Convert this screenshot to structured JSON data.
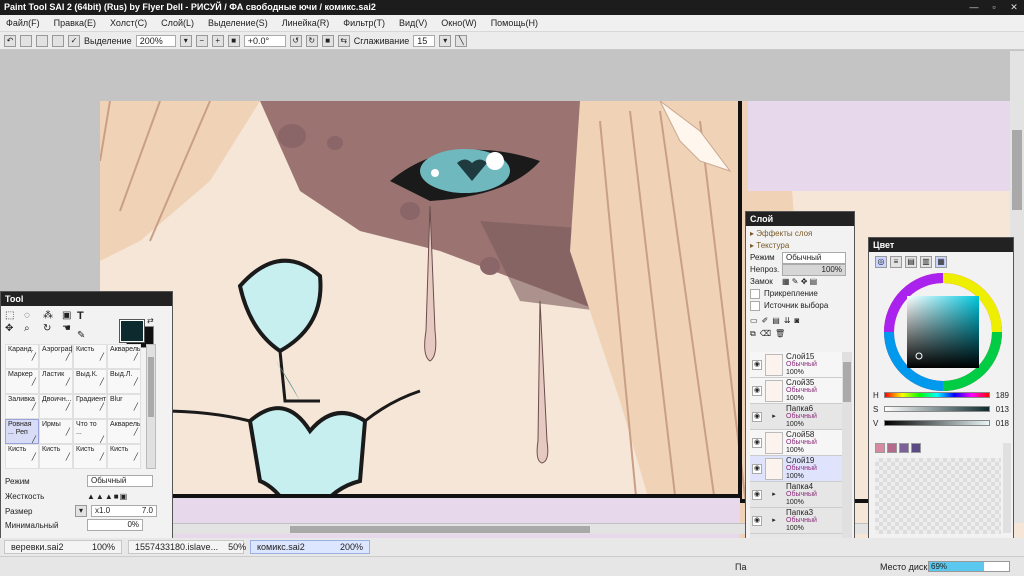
{
  "window": {
    "title": "Paint Tool SAI 2 (64bit) (Rus) by Flyer Dell - РИСУЙ / ФА свободные ючи / комикс.sai2"
  },
  "menu": [
    "Файл(F)",
    "Правка(E)",
    "Холст(C)",
    "Слой(L)",
    "Выделение(S)",
    "Линейка(R)",
    "Фильтр(T)",
    "Вид(V)",
    "Окно(W)",
    "Помощь(H)"
  ],
  "toolbar": {
    "selection_label": "Выделение",
    "zoom": "200%",
    "rotation": "+0.0°",
    "smoothing_label": "Сглаживание",
    "smoothing_value": "15"
  },
  "tool_panel": {
    "title": "Tool",
    "tools": [
      [
        "Каранд.",
        "Аэрограф",
        "Кисть",
        "Акварель"
      ],
      [
        "Маркер",
        "Ластик",
        "Выд.К.",
        "Выд.Л."
      ],
      [
        "Заливка",
        "Двоичн...",
        "Градиент",
        "Blur"
      ],
      [
        "Ровная ... Реп",
        "Ирмы",
        "Что то ...",
        "Акварель"
      ],
      [
        "Кисть",
        "Кисть",
        "Кисть",
        "Кисть"
      ]
    ],
    "mode_label": "Режим",
    "mode_value": "Обычный",
    "hardness_label": "Жесткость",
    "size_label": "Размер",
    "size_multiplier": "x1.0",
    "size_value": "7.0",
    "min_label": "Минимальный",
    "min_value": "0%",
    "fg_color": "#0d2a2e",
    "bg_color": "#111111"
  },
  "layer_panel": {
    "title": "Слой",
    "effects": "Эффекты слоя",
    "texture": "Текстура",
    "mode_label": "Режим",
    "mode_value": "Обычный",
    "opacity_label": "Непроз.",
    "opacity_value": "100%",
    "lock_label": "Замок",
    "clip_label": "Прикрепление",
    "source_label": "Источник выбора",
    "layers": [
      {
        "name": "Слой15",
        "mode": "Обычный",
        "opacity": "100%",
        "type": "layer"
      },
      {
        "name": "Слой35",
        "mode": "Обычный",
        "opacity": "100%",
        "type": "layer"
      },
      {
        "name": "Папка6",
        "mode": "Обычный",
        "opacity": "100%",
        "type": "folder"
      },
      {
        "name": "Слой58",
        "mode": "Обычный",
        "opacity": "100%",
        "type": "layer"
      },
      {
        "name": "Слой19",
        "mode": "Обычный",
        "opacity": "100%",
        "type": "selected"
      },
      {
        "name": "Папка4",
        "mode": "Обычный",
        "opacity": "100%",
        "type": "folder"
      },
      {
        "name": "Папка3",
        "mode": "Обычный",
        "opacity": "100%",
        "type": "folder"
      },
      {
        "name": "Папка2",
        "mode": "Обычный",
        "opacity": "",
        "type": "folder"
      }
    ]
  },
  "color_panel": {
    "title": "Цвет",
    "h_label": "H",
    "h_value": "189",
    "s_label": "S",
    "s_value": "013",
    "v_label": "V",
    "v_value": "018",
    "swatches": [
      "#d98aa0",
      "#b56c8c",
      "#7d5f9a",
      "#5b4a86"
    ]
  },
  "doc_tabs": [
    {
      "name": "веревки.sai2",
      "zoom": "100%"
    },
    {
      "name": "1557433180.islave...",
      "zoom": "50%"
    },
    {
      "name": "комикс.sai2",
      "zoom": "200%"
    }
  ],
  "status": {
    "disk_label": "Место диска",
    "disk_value": "69%",
    "prefix": "Па"
  }
}
